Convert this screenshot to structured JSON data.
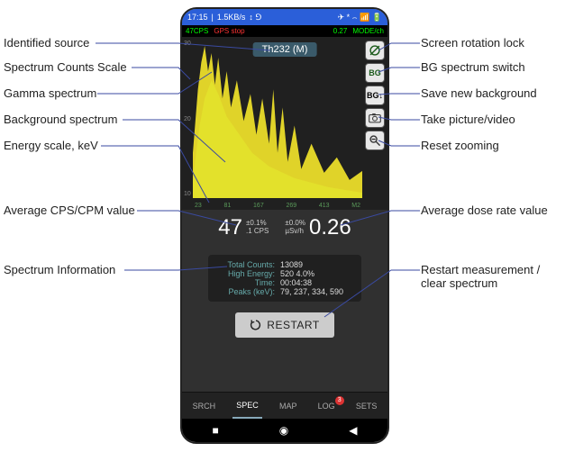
{
  "statusbar": {
    "time": "17:15",
    "net": "1.5KB/s",
    "icons_l": "↕ ⅁",
    "icons_r": "✈ * ⌢ 📶 🔋"
  },
  "gpsbar": {
    "left1": "47CPS",
    "left2": "GPS stop",
    "right1": "0.27",
    "right2": "MODE/ch"
  },
  "identified": "Th232 (M)",
  "yticks": [
    "30",
    "20",
    "10"
  ],
  "xticks": [
    "23",
    "81",
    "167",
    "269",
    "413",
    "M2"
  ],
  "metrics": {
    "cps": "47",
    "cps_err": "±0.1%",
    "cps_unit": ".1 CPS",
    "dose_err": "±0.0%",
    "dose_unit": "µSv/h",
    "dose": "0.26"
  },
  "info": {
    "total_counts_lbl": "Total Counts:",
    "total_counts": "13089",
    "high_e_lbl": "High Energy:",
    "high_e": "520 4.0%",
    "time_lbl": "Time:",
    "time": "00:04:38",
    "peaks_lbl": "Peaks (keV):",
    "peaks": "79, 237, 334, 590"
  },
  "restart": "RESTART",
  "tabs": {
    "srch": "SRCH",
    "spec": "SPEC",
    "map": "MAP",
    "log": "LOG",
    "sets": "SETS",
    "badge": "3"
  },
  "annotations": {
    "identified_source": "Identified source",
    "counts_scale": "Spectrum Counts Scale",
    "gamma": "Gamma spectrum",
    "bg_spec": "Background spectrum",
    "escale": "Energy scale, keV",
    "avg_cps": "Average CPS/CPM value",
    "spec_info": "Spectrum Information",
    "rot_lock": "Screen rotation lock",
    "bg_switch": "BG spectrum switch",
    "save_bg": "Save new background",
    "picture": "Take picture/video",
    "reset_zoom": "Reset zooming",
    "avg_dose": "Average dose rate value",
    "restart": "Restart measurement /\nclear spectrum"
  }
}
